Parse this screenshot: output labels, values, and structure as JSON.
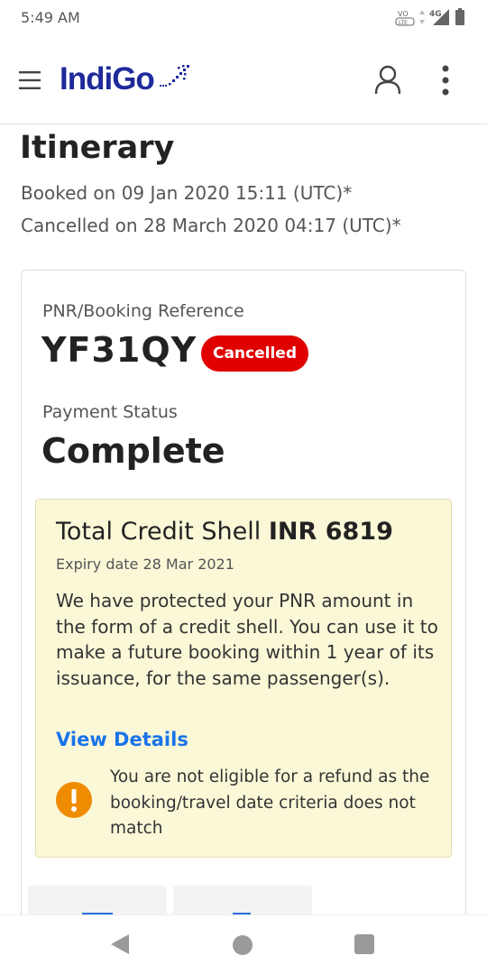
{
  "status_bar": {
    "time": "5:49 AM",
    "network": "4G",
    "volte": "VoLTE",
    "icons": [
      "volte-icon",
      "data-arrows-icon",
      "signal-icon",
      "battery-icon"
    ]
  },
  "header": {
    "brand": "IndiGo",
    "icons": [
      "menu-icon",
      "plane-logo-icon",
      "profile-icon",
      "more-vertical-icon"
    ],
    "brand_color": "#1e2a9b"
  },
  "itinerary": {
    "title": "Itinerary",
    "booked_on": "Booked on 09 Jan 2020 15:11 (UTC)*",
    "cancelled_on": "Cancelled on 28 March 2020 04:17 (UTC)*"
  },
  "booking": {
    "pnr_label": "PNR/Booking Reference",
    "pnr_value": "YF31QY",
    "status_badge": "Cancelled",
    "status_color": "#e00000",
    "payment_label": "Payment Status",
    "payment_value": "Complete"
  },
  "credit_shell": {
    "title_prefix": "Total Credit Shell",
    "amount": "INR 6819",
    "expiry": "Expiry date 28 Mar 2021",
    "description": "We have protected your PNR amount in the form of a credit shell. You can use it to make a future booking within 1 year of its issuance, for the same passenger(s).",
    "view_details": "View Details",
    "link_color": "#1a73e8",
    "warning": "You are not eligible for a refund as the booking/travel date criteria does not match",
    "warning_color": "#f08c00",
    "background": "#fbf8d8"
  },
  "nav": {
    "icons": [
      "back-icon",
      "home-icon",
      "recents-icon"
    ]
  }
}
